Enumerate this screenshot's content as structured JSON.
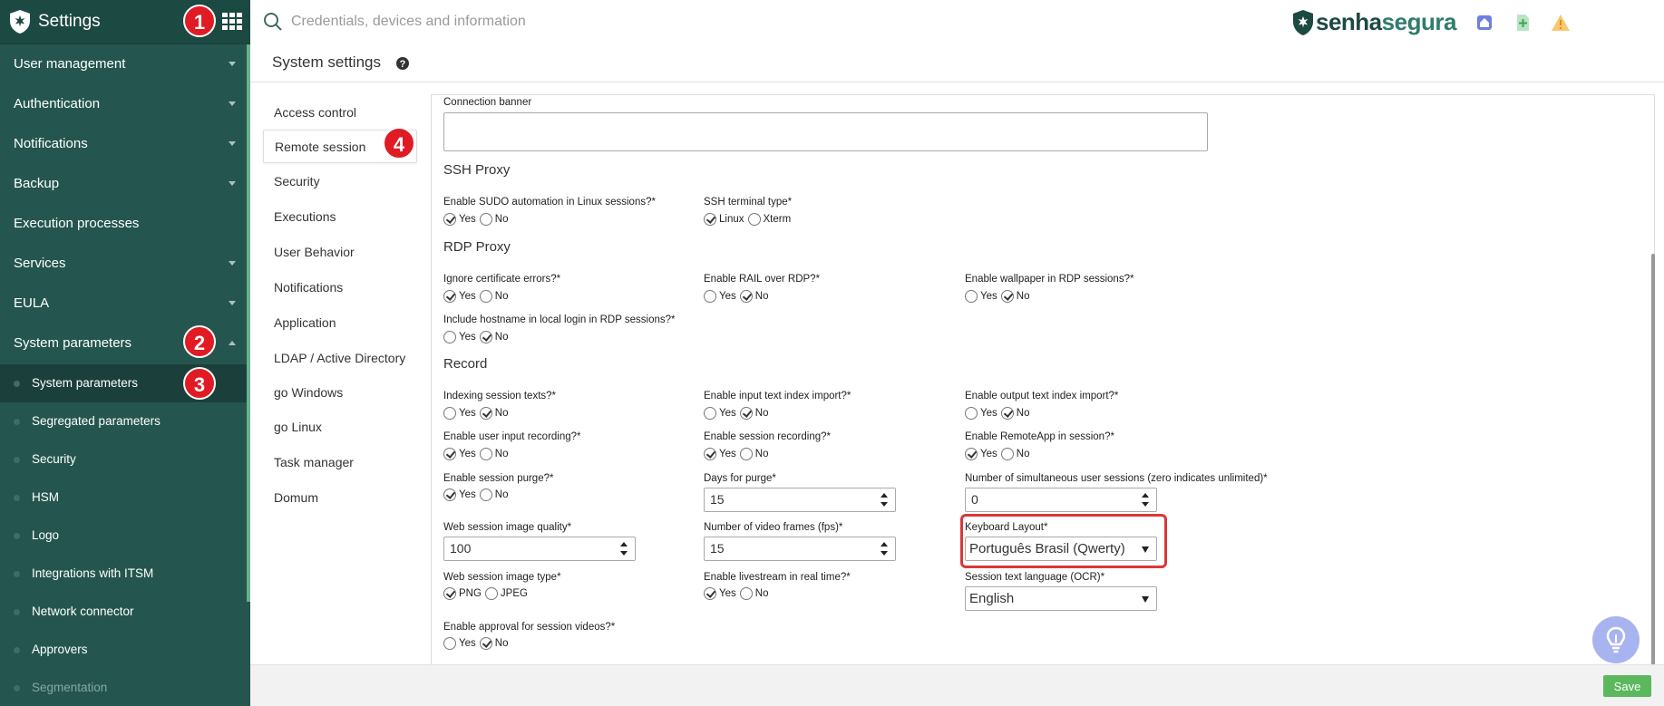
{
  "sidebar": {
    "title": "Settings",
    "items": [
      {
        "label": "User management"
      },
      {
        "label": "Authentication"
      },
      {
        "label": "Notifications"
      },
      {
        "label": "Backup"
      },
      {
        "label": "Execution processes"
      },
      {
        "label": "Services"
      },
      {
        "label": "EULA"
      },
      {
        "label": "System parameters"
      }
    ],
    "subitems": [
      {
        "label": "System parameters"
      },
      {
        "label": "Segregated parameters"
      },
      {
        "label": "Security"
      },
      {
        "label": "HSM"
      },
      {
        "label": "Logo"
      },
      {
        "label": "Integrations with ITSM"
      },
      {
        "label": "Network connector"
      },
      {
        "label": "Approvers"
      },
      {
        "label": "Segmentation"
      }
    ]
  },
  "badges": [
    "1",
    "2",
    "3",
    "4"
  ],
  "topbar": {
    "search_placeholder": "Credentials, devices and information",
    "brand_part1": "senha",
    "brand_part2": "segura"
  },
  "page": {
    "title": "System settings"
  },
  "left_nav": [
    "Access control",
    "Remote session",
    "Security",
    "Executions",
    "User Behavior",
    "Notifications",
    "Application",
    "LDAP / Active Directory",
    "go Windows",
    "go Linux",
    "Task manager",
    "Domum"
  ],
  "form": {
    "connection_banner": "Connection banner",
    "ssh_proxy": "SSH Proxy",
    "sudo_label": "Enable SUDO automation in Linux sessions?*",
    "ssh_terminal_label": "SSH terminal type*",
    "linux": "Linux",
    "xterm": "Xterm",
    "rdp_proxy": "RDP Proxy",
    "ignore_cert_label": "Ignore certificate errors?*",
    "rail_label": "Enable RAIL over RDP?*",
    "wallpaper_label": "Enable wallpaper in RDP sessions?*",
    "hostname_label": "Include hostname in local login in RDP sessions?*",
    "record": "Record",
    "indexing_label": "Indexing session texts?*",
    "input_index_label": "Enable input text index import?*",
    "output_index_label": "Enable output text index import?*",
    "user_input_label": "Enable user input recording?*",
    "session_rec_label": "Enable session recording?*",
    "remoteapp_label": "Enable RemoteApp in session?*",
    "purge_label": "Enable session purge?*",
    "days_purge_label": "Days for purge*",
    "days_purge_value": "15",
    "simultaneous_label": "Number of simultaneous user sessions (zero indicates unlimited)*",
    "simultaneous_value": "0",
    "img_quality_label": "Web session image quality*",
    "img_quality_value": "100",
    "fps_label": "Number of video frames (fps)*",
    "fps_value": "15",
    "keyboard_label": "Keyboard Layout*",
    "keyboard_value": "Português Brasil (Qwerty)",
    "img_type_label": "Web session image type*",
    "png": "PNG",
    "jpeg": "JPEG",
    "livestream_label": "Enable livestream in real time?*",
    "ocr_label": "Session text language (OCR)*",
    "ocr_value": "English",
    "approval_label": "Enable approval for session videos?*",
    "yes": "Yes",
    "no": "No"
  },
  "footer": {
    "save_label": "Save"
  }
}
